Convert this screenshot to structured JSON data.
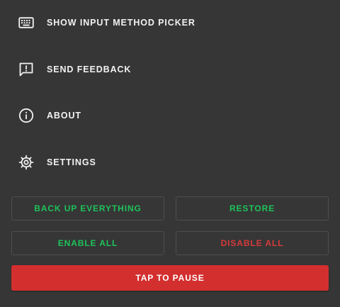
{
  "colors": {
    "background": "#363636",
    "text": "#f2f2f2",
    "green_accent": "#1ec25a",
    "red_accent": "#d73a3a",
    "pause_button": "#d32f2f"
  },
  "menu": {
    "items": [
      {
        "label": "SHOW INPUT METHOD PICKER",
        "icon": "keyboard-icon"
      },
      {
        "label": "SEND FEEDBACK",
        "icon": "feedback-icon"
      },
      {
        "label": "ABOUT",
        "icon": "info-icon"
      },
      {
        "label": "SETTINGS",
        "icon": "gear-icon"
      }
    ]
  },
  "actions": {
    "backup_label": "BACK UP EVERYTHING",
    "restore_label": "RESTORE",
    "enable_all_label": "ENABLE ALL",
    "disable_all_label": "DISABLE ALL",
    "pause_label": "TAP TO PAUSE"
  }
}
